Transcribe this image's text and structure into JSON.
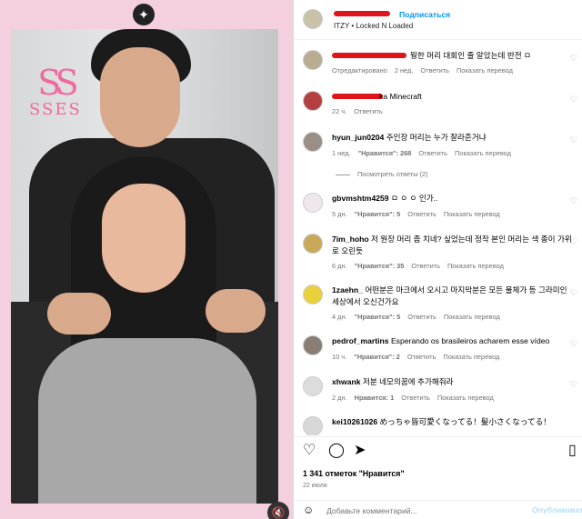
{
  "post": {
    "follow_label": "Подписаться",
    "separator": "•",
    "music": "ITZY • Locked N Loaded",
    "logo_text": "SSES"
  },
  "comments": [
    {
      "username": "",
      "text": "뭥한 머리 대회인 줄 알았는데 반전 ㅁ",
      "time": "2 нед.",
      "status": "Отредактировано",
      "reply": "Ответить",
      "translate": "Показать перевод",
      "likes": ""
    },
    {
      "username": "",
      "text": "ka Minecraft",
      "time": "22 ч.",
      "reply": "Ответить"
    },
    {
      "username": "hyun_jun0204",
      "text": "주인장 머리는 누가 잘라준거냐",
      "time": "1 нед.",
      "likes": "\"Нравится\": 268",
      "reply": "Ответить",
      "translate": "Показать перевод"
    },
    {
      "username": "gbvmshtm4259",
      "text": "ㅁ ㅇ ㅇ 인가..",
      "time": "5 дн.",
      "likes": "\"Нравится\": 5",
      "reply": "Ответить",
      "translate": "Показать перевод"
    },
    {
      "username": "7im_hoho",
      "text": "저 원장 머리 좀 치네? 싶었는데 정작 본인 머리는 색 종이 가위로 오린듯",
      "time": "6 дн.",
      "likes": "\"Нравится\": 35",
      "reply": "Ответить",
      "translate": "Показать перевод"
    },
    {
      "username": "1zaehn_",
      "text": "어떤분은 마크에서 오시고 마지막분은 모든 물체가 등 그라미인 세상에서 오신건가요",
      "time": "4 дн.",
      "likes": "\"Нравится\": 5",
      "reply": "Ответить",
      "translate": "Показать перевод"
    },
    {
      "username": "pedrof_martins",
      "text": "Esperando os brasileiros acharem esse vídeo",
      "time": "10 ч.",
      "likes": "\"Нравится\": 2",
      "reply": "Ответить",
      "translate": "Показать перевод"
    },
    {
      "username": "xhwank",
      "text": "저분 네모의꿈에 추가해줘라",
      "time": "2 дн.",
      "likes": "Нравится: 1",
      "reply": "Ответить",
      "translate": "Показать перевод"
    },
    {
      "username": "kei10261026",
      "text": "めっちゃ皆可愛くなってる！髪小さくなってる！",
      "time": "",
      "likes": "",
      "reply": "",
      "translate": ""
    }
  ],
  "view_replies": "Посмотреть ответы (2)",
  "likes_label": "1 341 отметок \"Нравится\"",
  "date_label": "22 июля",
  "add_comment": {
    "placeholder": "Добавьте комментарий...",
    "publish": "Опубликовать"
  },
  "icons": [
    "heart-icon",
    "comment-icon",
    "share-icon",
    "bookmark-icon",
    "emoji-icon",
    "sparkle-icon",
    "mute-icon"
  ],
  "colors": {
    "accent": "#0095f6",
    "redaction": "#e0151b",
    "publish_disabled": "#b2dffc",
    "media_bg": "#f3c9dc"
  }
}
